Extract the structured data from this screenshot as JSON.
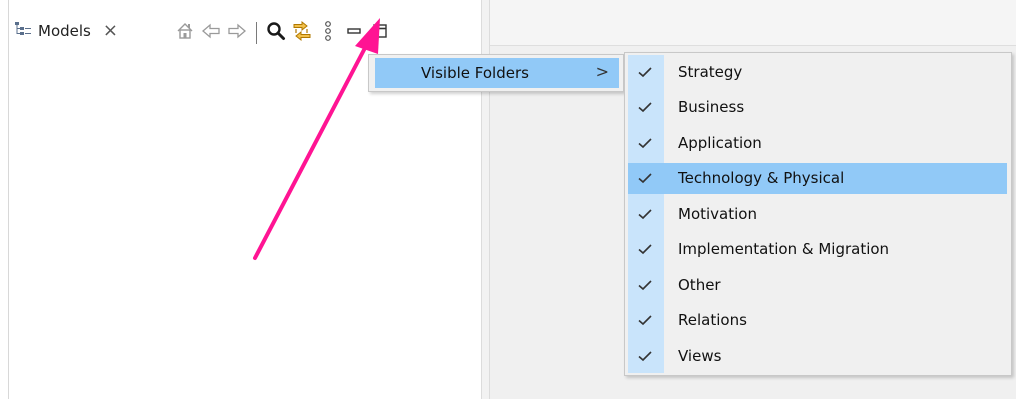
{
  "tab": {
    "label": "Models",
    "close": "×"
  },
  "toolbar": {
    "buttons": [
      "home-icon",
      "back-icon",
      "forward-icon",
      "search-icon",
      "link-icon",
      "view-menu-icon",
      "minimize-icon",
      "maximize-icon"
    ]
  },
  "menu": {
    "item_label": "Visible Folders",
    "submenu_arrow": ">"
  },
  "submenu": {
    "items": [
      {
        "label": "Strategy",
        "checked": true
      },
      {
        "label": "Business",
        "checked": true
      },
      {
        "label": "Application",
        "checked": true
      },
      {
        "label": "Technology & Physical",
        "checked": true,
        "highlighted": true
      },
      {
        "label": "Motivation",
        "checked": true
      },
      {
        "label": "Implementation & Migration",
        "checked": true
      },
      {
        "label": "Other",
        "checked": true
      },
      {
        "label": "Relations",
        "checked": true
      },
      {
        "label": "Views",
        "checked": true
      }
    ]
  },
  "colors": {
    "highlight": "#91c9f7",
    "check_column": "#c9e4fb",
    "annotation_arrow": "#ff1493",
    "link_icon": "#e8a317"
  }
}
